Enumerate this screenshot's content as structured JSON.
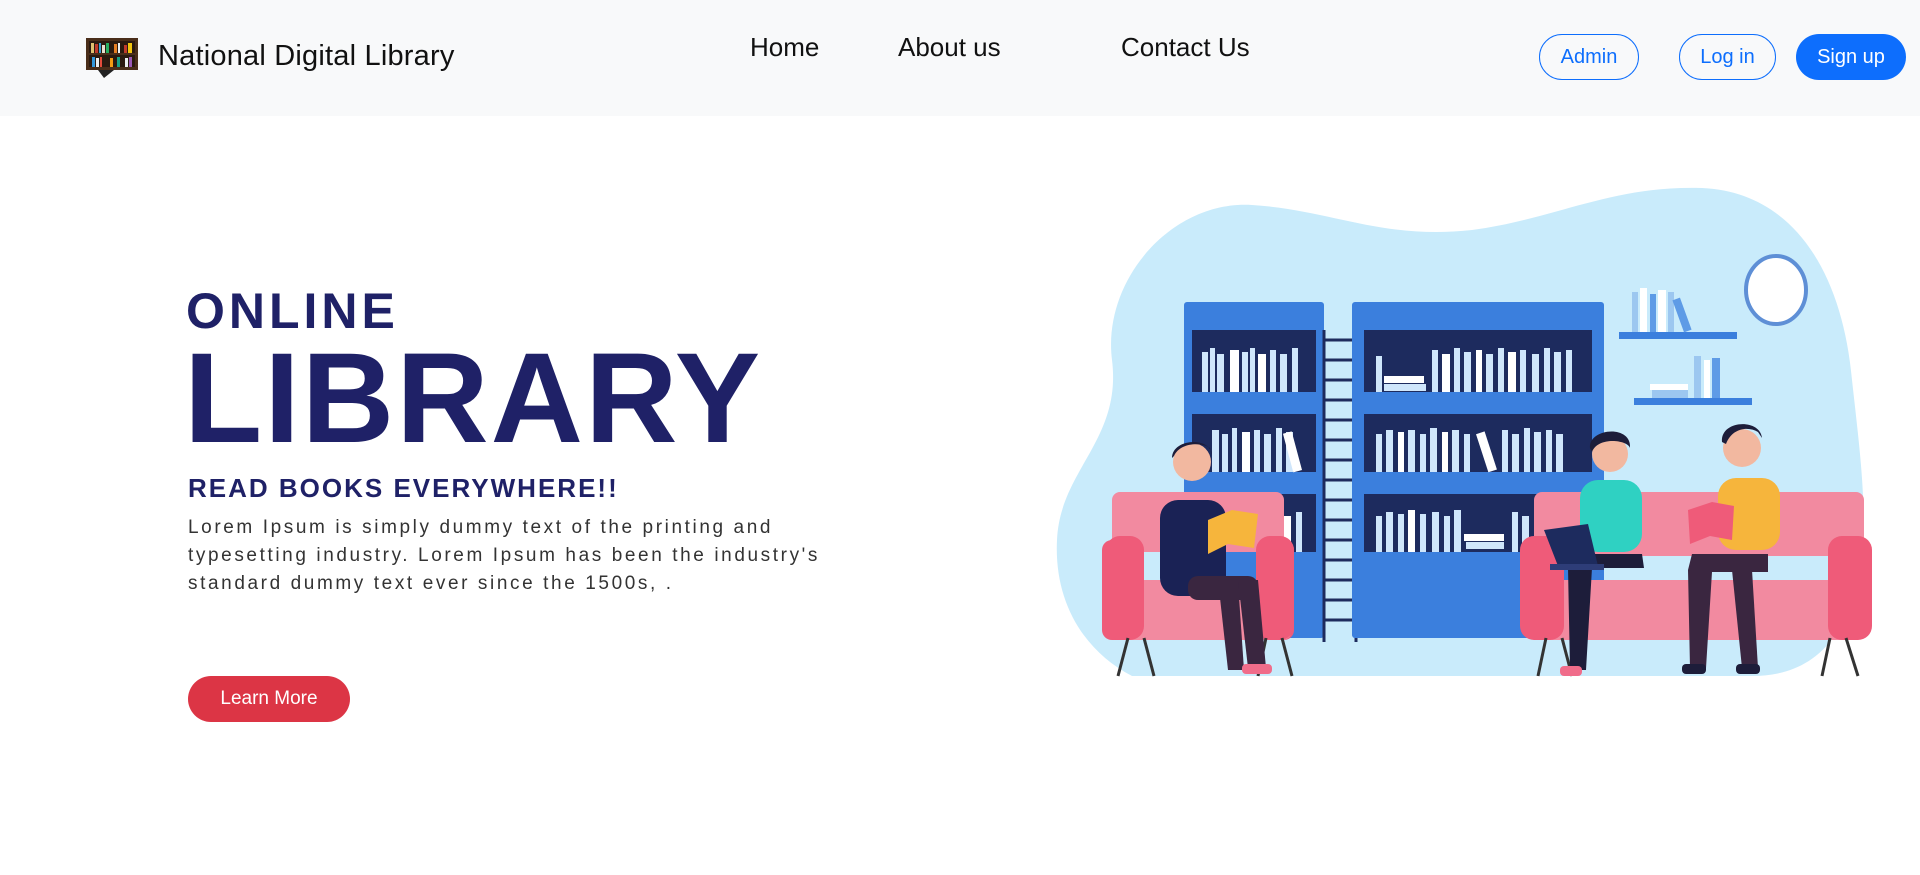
{
  "navbar": {
    "brand_name": "National Digital Library",
    "logo_icon": "bookshelf-logo-icon",
    "links": {
      "home": "Home",
      "about": "About us",
      "contact": "Contact Us"
    },
    "buttons": {
      "admin": "Admin",
      "login": "Log in",
      "signup": "Sign up"
    }
  },
  "hero": {
    "small_title": "ONLINE",
    "big_title": "LIBRARY",
    "tagline": "READ BOOKS EVERYWHERE!!",
    "description": "Lorem Ipsum is simply dummy text of the printing and typesetting industry. Lorem Ipsum has been the industry's standard dummy text ever since the 1500s, .",
    "cta_label": "Learn More",
    "illustration_icon": "library-reading-illustration"
  },
  "colors": {
    "navbar_bg": "#f8f9fa",
    "primary": "#0d6efd",
    "danger": "#dc3545",
    "hero_title": "#1f2167",
    "blob": "#c9ebfb",
    "shelf": "#3b7fdd",
    "sofa": "#f0607a"
  }
}
